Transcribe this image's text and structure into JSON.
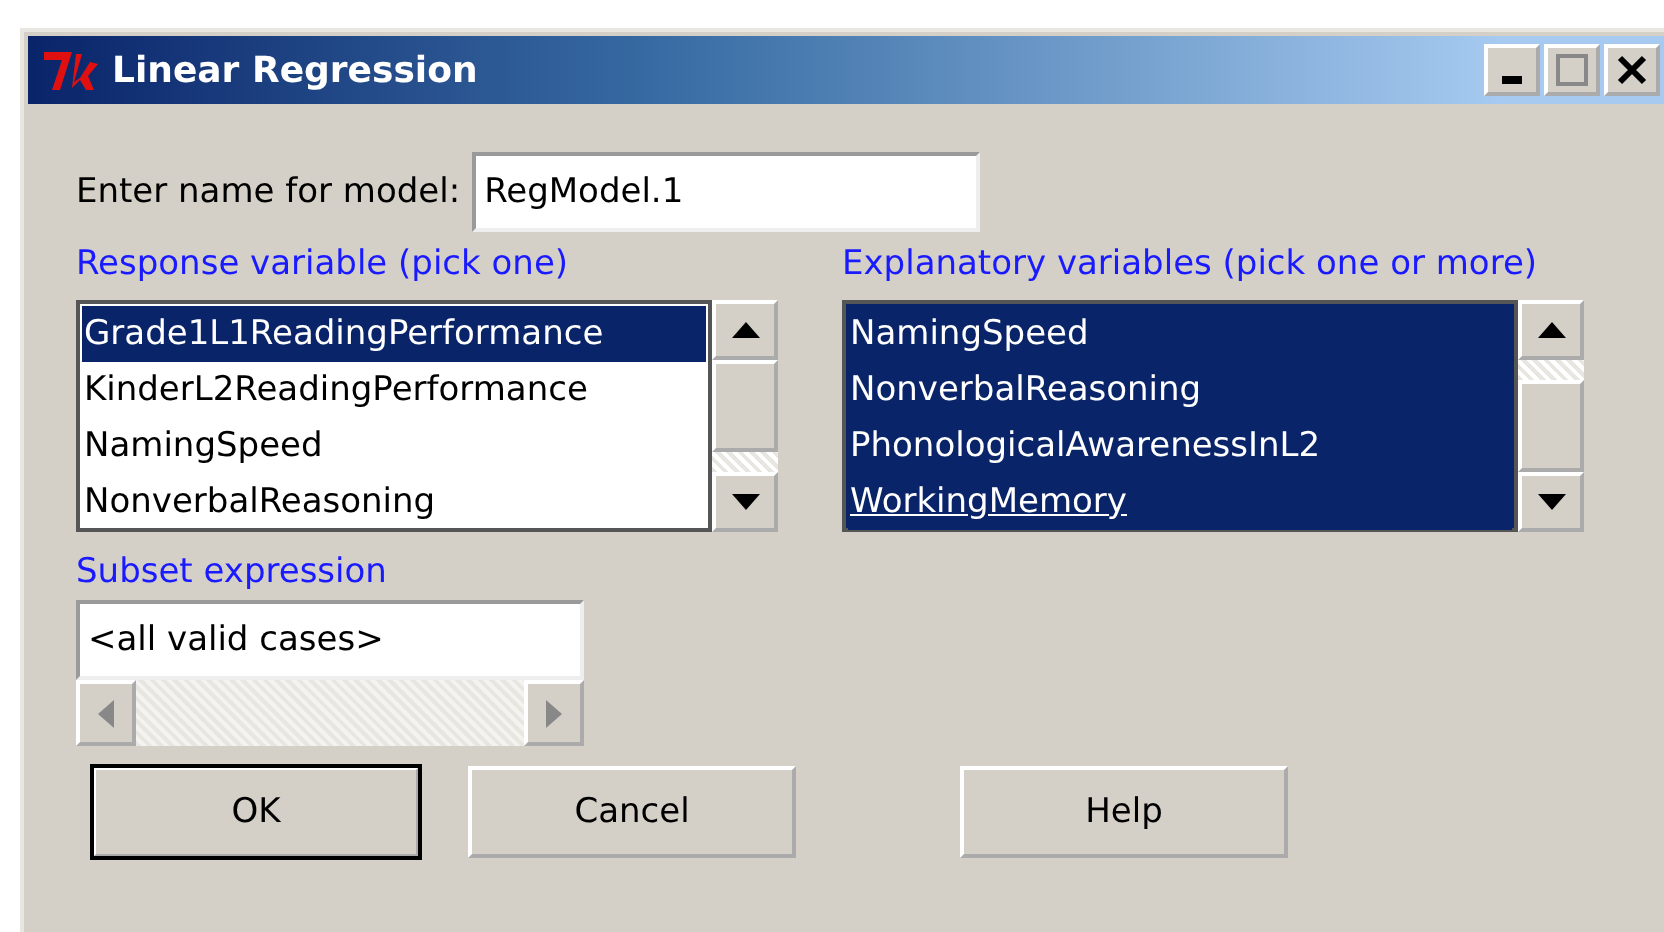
{
  "window": {
    "title": "Linear Regression"
  },
  "model_name": {
    "label": "Enter name for model:",
    "value": "RegModel.1"
  },
  "response": {
    "label": "Response variable (pick one)",
    "items": [
      {
        "text": "Grade1L1ReadingPerformance",
        "selected": true,
        "focused": false
      },
      {
        "text": "KinderL2ReadingPerformance",
        "selected": false,
        "focused": false
      },
      {
        "text": "NamingSpeed",
        "selected": false,
        "focused": false
      },
      {
        "text": "NonverbalReasoning",
        "selected": false,
        "focused": false
      }
    ]
  },
  "explanatory": {
    "label": "Explanatory variables (pick one or more)",
    "items": [
      {
        "text": "NamingSpeed",
        "selected": true,
        "focused": false
      },
      {
        "text": "NonverbalReasoning",
        "selected": true,
        "focused": false
      },
      {
        "text": "PhonologicalAwarenessInL2",
        "selected": true,
        "focused": false
      },
      {
        "text": "WorkingMemory",
        "selected": true,
        "focused": true
      }
    ]
  },
  "subset": {
    "label": "Subset expression",
    "value": "<all valid cases>"
  },
  "buttons": [
    {
      "label": "OK",
      "default": true
    },
    {
      "label": "Cancel",
      "default": false
    },
    {
      "label": "Help",
      "default": false
    }
  ]
}
